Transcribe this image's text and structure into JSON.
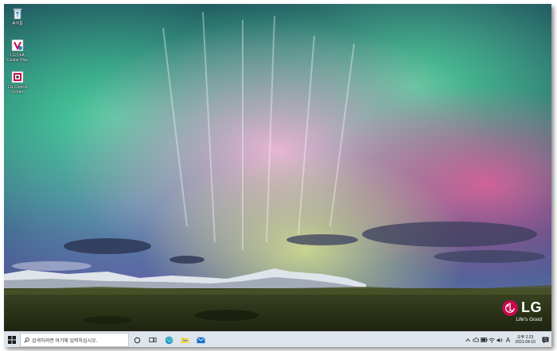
{
  "desktop": {
    "icons": [
      {
        "name": "recycle-bin",
        "label": "휴지통"
      },
      {
        "name": "lg-dnlk-center-plus",
        "label": "LG DnA\nCenter Plus"
      },
      {
        "name": "lg-control-center",
        "label": "LG Control\nCenter"
      }
    ]
  },
  "branding": {
    "logo_text": "LG",
    "tagline": "Life's Good",
    "brand_color": "#c6094b"
  },
  "taskbar": {
    "search_placeholder": "검색하려면 여기에 입력하십시오.",
    "apps": [
      "cortana-icon",
      "task-view-icon",
      "edge-icon",
      "file-explorer-icon",
      "mail-icon"
    ],
    "ime_label": "A",
    "clock_time": "오후 2:23",
    "clock_date": "2021-04-15"
  }
}
